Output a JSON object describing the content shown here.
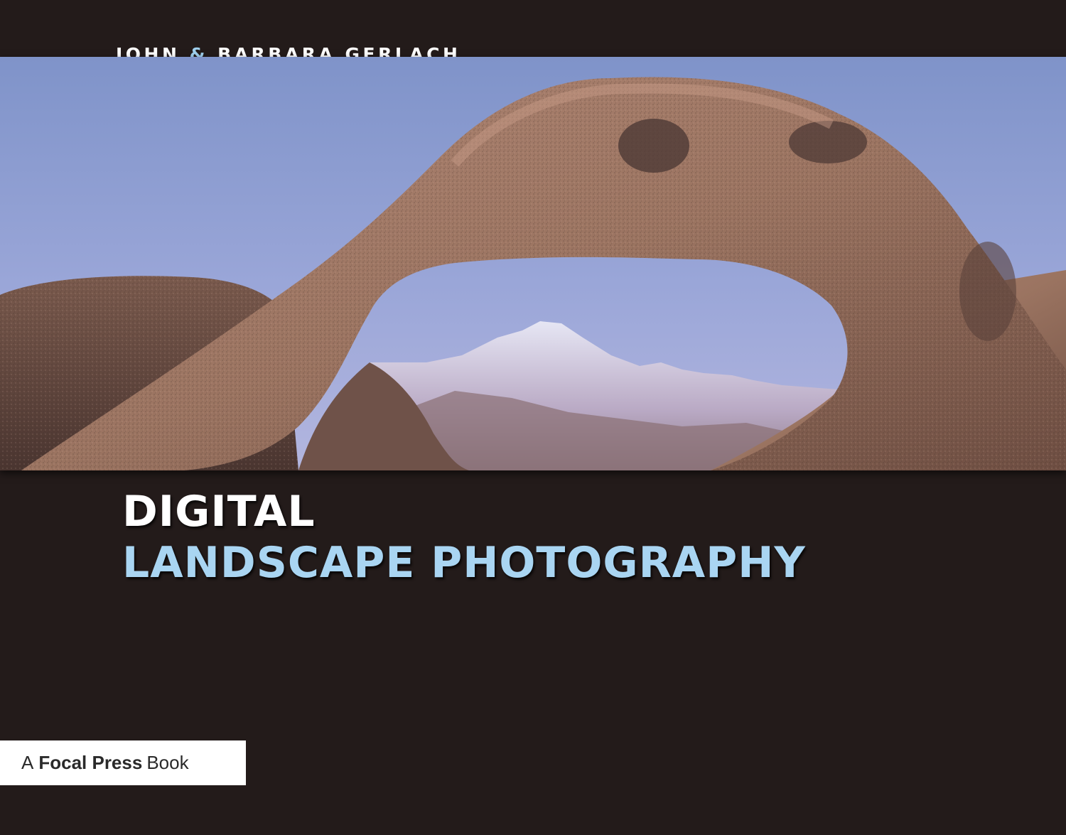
{
  "cover": {
    "authors": {
      "first": "JOHN",
      "amp": "&",
      "second": "BARBARA GERLACH"
    },
    "title": {
      "line1": "DIGITAL",
      "line2": "LANDSCAPE PHOTOGRAPHY"
    },
    "publisher": {
      "prefix": "A",
      "brand": "Focal Press",
      "suffix": "Book"
    },
    "colors": {
      "background": "#231b1a",
      "title_accent": "#a9d5f2",
      "author_amp": "#9fd0ee",
      "sky": "#9aa6d6",
      "rock": "#9b7461"
    }
  }
}
